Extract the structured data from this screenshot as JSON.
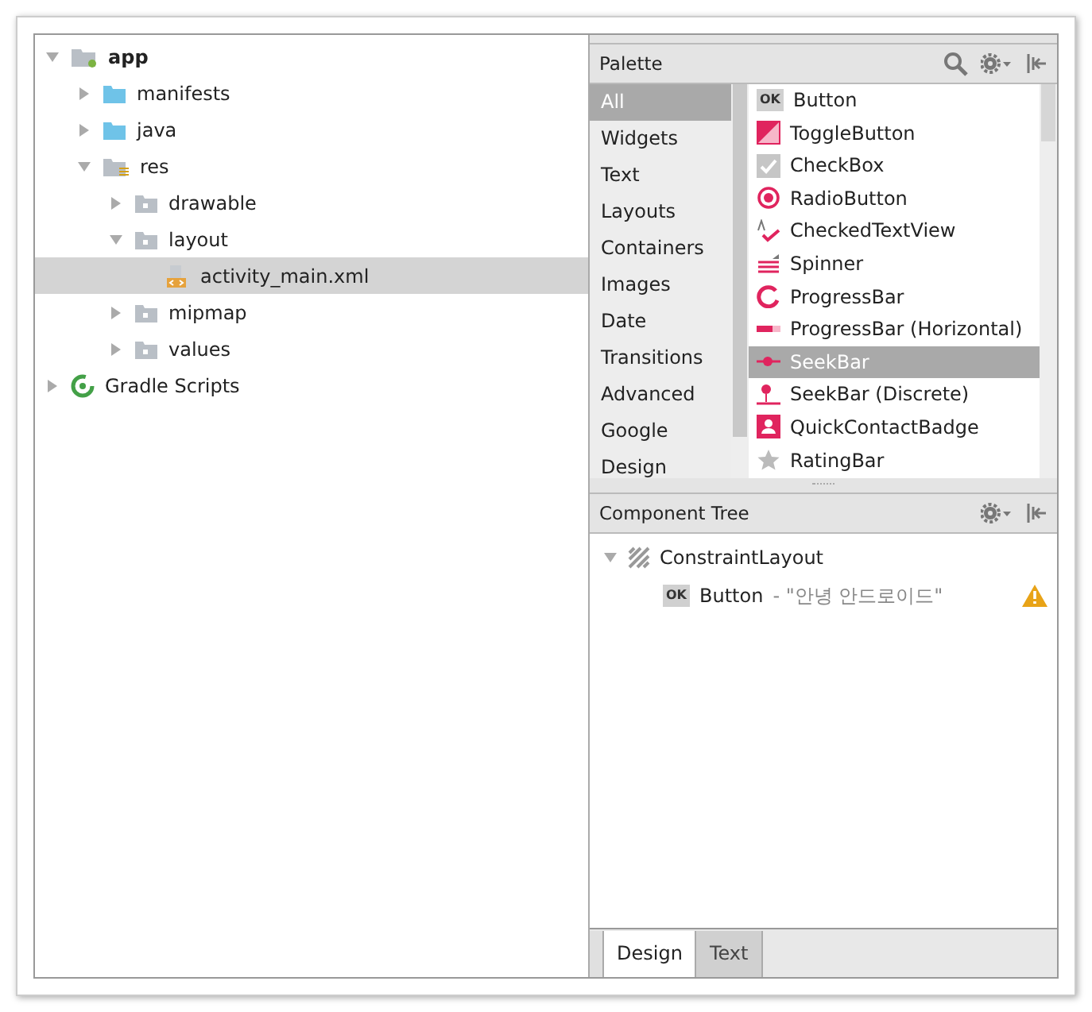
{
  "project_tree": [
    {
      "label": "app",
      "kind": "module",
      "bold": true,
      "expanded": true,
      "selected": false,
      "children": [
        {
          "label": "manifests",
          "kind": "folder",
          "bold": false,
          "expanded": false,
          "selected": false
        },
        {
          "label": "java",
          "kind": "folder",
          "bold": false,
          "expanded": false,
          "selected": false
        },
        {
          "label": "res",
          "kind": "res-folder",
          "bold": false,
          "expanded": true,
          "selected": false,
          "children": [
            {
              "label": "drawable",
              "kind": "package",
              "bold": false,
              "expanded": false,
              "selected": false
            },
            {
              "label": "layout",
              "kind": "package",
              "bold": false,
              "expanded": true,
              "selected": false,
              "children": [
                {
                  "label": "activity_main.xml",
                  "kind": "xml",
                  "bold": false,
                  "selected": true
                }
              ]
            },
            {
              "label": "mipmap",
              "kind": "package",
              "bold": false,
              "expanded": false,
              "selected": false
            },
            {
              "label": "values",
              "kind": "package",
              "bold": false,
              "expanded": false,
              "selected": false
            }
          ]
        }
      ]
    },
    {
      "label": "Gradle Scripts",
      "kind": "gradle",
      "bold": false,
      "expanded": false,
      "selected": false
    }
  ],
  "palette": {
    "title": "Palette",
    "categories": [
      {
        "label": "All",
        "selected": true
      },
      {
        "label": "Widgets",
        "selected": false
      },
      {
        "label": "Text",
        "selected": false
      },
      {
        "label": "Layouts",
        "selected": false
      },
      {
        "label": "Containers",
        "selected": false
      },
      {
        "label": "Images",
        "selected": false
      },
      {
        "label": "Date",
        "selected": false
      },
      {
        "label": "Transitions",
        "selected": false
      },
      {
        "label": "Advanced",
        "selected": false
      },
      {
        "label": "Google",
        "selected": false
      },
      {
        "label": "Design",
        "selected": false
      }
    ],
    "items": [
      {
        "label": "Button",
        "kind": "ok",
        "icon_text": "OK",
        "selected": false
      },
      {
        "label": "ToggleButton",
        "kind": "toggle",
        "selected": false
      },
      {
        "label": "CheckBox",
        "kind": "checkbox",
        "selected": false
      },
      {
        "label": "RadioButton",
        "kind": "radio",
        "selected": false
      },
      {
        "label": "CheckedTextView",
        "kind": "checkedtext",
        "selected": false
      },
      {
        "label": "Spinner",
        "kind": "spinner",
        "selected": false
      },
      {
        "label": "ProgressBar",
        "kind": "progress",
        "selected": false
      },
      {
        "label": "ProgressBar (Horizontal)",
        "kind": "hprogress",
        "selected": false
      },
      {
        "label": "SeekBar",
        "kind": "seek",
        "selected": true
      },
      {
        "label": "SeekBar (Discrete)",
        "kind": "discrete",
        "selected": false
      },
      {
        "label": "QuickContactBadge",
        "kind": "badge",
        "selected": false
      },
      {
        "label": "RatingBar",
        "kind": "star",
        "selected": false
      }
    ]
  },
  "component_tree": {
    "title": "Component Tree",
    "nodes": [
      {
        "label": "ConstraintLayout",
        "kind": "constraint",
        "expanded": true,
        "children": [
          {
            "label": "Button",
            "icon_text": "OK",
            "detail": "- \"안녕 안드로이드\"",
            "kind": "ok",
            "warning": true
          }
        ]
      }
    ]
  },
  "tabs": [
    {
      "label": "Design",
      "selected": true
    },
    {
      "label": "Text",
      "selected": false
    }
  ]
}
